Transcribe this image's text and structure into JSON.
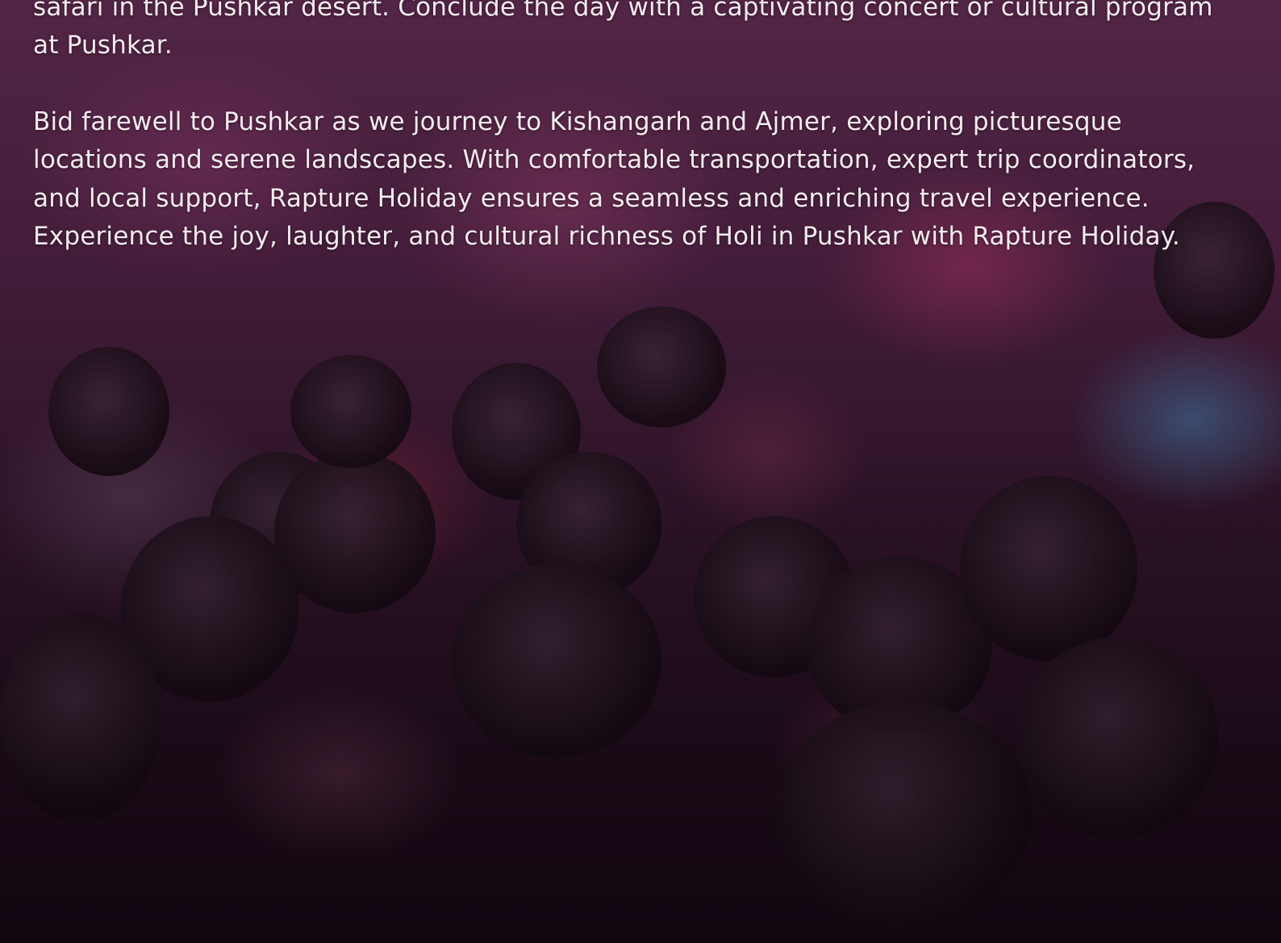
{
  "background_image": {
    "subject": "crowd-celebrating-holi",
    "tint_color": "#5a2a4c"
  },
  "text": {
    "paragraph_1": "safari in the Pushkar desert. Conclude the day with a captivating concert or cultural program at Pushkar.",
    "paragraph_2": "Bid farewell to Pushkar as we journey to Kishangarh and Ajmer, exploring picturesque locations and serene landscapes. With comfortable transportation, expert trip coordinators, and local support, Rapture Holiday ensures a seamless and enriching travel experience.",
    "paragraph_3": "Experience the joy, laughter, and cultural richness of Holi in Pushkar with Rapture Holiday."
  }
}
